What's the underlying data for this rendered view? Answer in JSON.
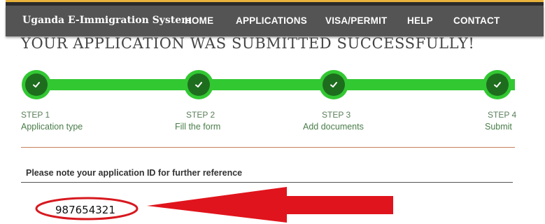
{
  "navbar": {
    "brand": "Uganda E-Immigration System",
    "links": [
      "HOME",
      "APPLICATIONS",
      "VISA/PERMIT",
      "HELP",
      "CONTACT"
    ]
  },
  "page_heading": "YOUR APPLICATION WAS SUBMITTED SUCCESSFULLY!",
  "steps": [
    {
      "number": "STEP 1",
      "label": "Application type",
      "completed": true
    },
    {
      "number": "STEP 2",
      "label": "Fill the form",
      "completed": true
    },
    {
      "number": "STEP 3",
      "label": "Add documents",
      "completed": true
    },
    {
      "number": "STEP 4",
      "label": "Submit",
      "completed": true
    }
  ],
  "note": "Please note your application ID for further reference",
  "application_id": "987654321",
  "icons": {
    "step_check": "check-icon",
    "callout": "red-arrow"
  },
  "colors": {
    "navbar": "#545454",
    "progress_green": "#32c832",
    "node_dark_green": "#1e6d1e",
    "annotation_red": "#e0141c"
  }
}
